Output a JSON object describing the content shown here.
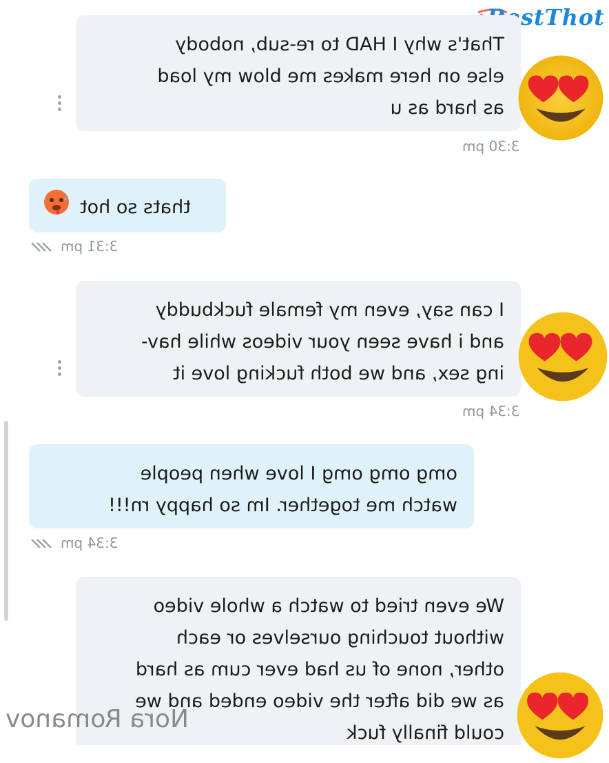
{
  "brand": {
    "name": "BestThot"
  },
  "messages": [
    {
      "id": "m1",
      "direction": "incoming",
      "text": "That's why I HAD to re-sub, nobody\nelse on here makes me blow my load\nas hard as u",
      "time": "3:30 pm",
      "reaction": "heart-eyes-emoji"
    },
    {
      "id": "m2",
      "direction": "outgoing",
      "text": "thats so hot",
      "time": "3:31 pm",
      "emoji": "hot-face-emoji",
      "status": "read"
    },
    {
      "id": "m3",
      "direction": "incoming",
      "text": "I can say, even my female fuckbuddy\nand i have seen your videos while hav-\ning sex, and we both fucking love it",
      "time": "3:34 pm",
      "reaction": "heart-eyes-emoji"
    },
    {
      "id": "m4",
      "direction": "outgoing",
      "text": "omg omg omg I love when people\nwatch me together. Im so happy rn!!!",
      "time": "3:34 pm",
      "status": "read"
    },
    {
      "id": "m5",
      "direction": "incoming",
      "text": "We even tried to watch a whole video\nwithout touching ourselves or each\nother, none of us had ever cum as hard\nas we did after the video ended and we\ncould finally fuck",
      "reaction": "heart-eyes-emoji"
    }
  ],
  "watermark": "Nora Romanov",
  "colors": {
    "incoming_bubble": "#eef2f4",
    "outgoing_bubble": "#dff2f9",
    "brand": "#1e88d8",
    "time": "#8d969d"
  }
}
